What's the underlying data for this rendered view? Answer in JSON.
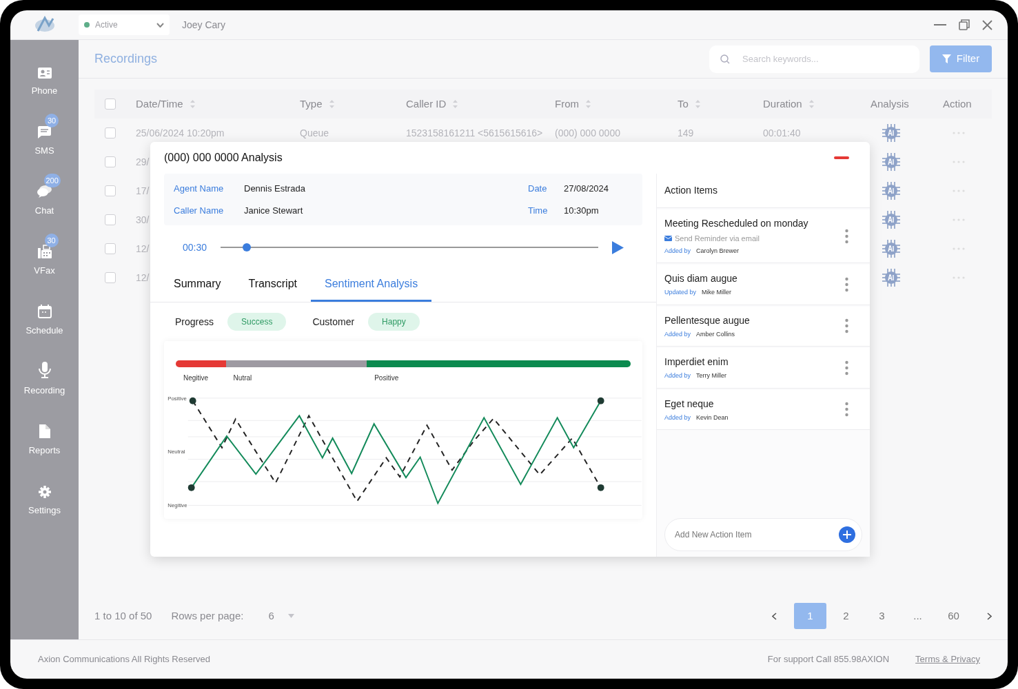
{
  "window": {
    "status": {
      "label": "Active",
      "color": "#5fae8a"
    },
    "user_name": "Joey Cary"
  },
  "sidebar": {
    "items": [
      {
        "kind": "phone",
        "label": "Phone"
      },
      {
        "kind": "sms",
        "label": "SMS",
        "badge": "30"
      },
      {
        "kind": "chat",
        "label": "Chat",
        "badge": "200"
      },
      {
        "kind": "vfax",
        "label": "VFax",
        "badge": "30"
      },
      {
        "kind": "schedule",
        "label": "Schedule"
      },
      {
        "kind": "recording",
        "label": "Recording"
      },
      {
        "kind": "reports",
        "label": "Reports"
      },
      {
        "kind": "settings",
        "label": "Settings"
      }
    ]
  },
  "page": {
    "title": "Recordings",
    "search": {
      "placeholder": "Search keywords..."
    },
    "filter_button": "Filter"
  },
  "table": {
    "header_checked": false,
    "columns": [
      {
        "label": "Date/Time",
        "sortable": true
      },
      {
        "label": "Type",
        "sortable": true
      },
      {
        "label": "Caller ID",
        "sortable": true
      },
      {
        "label": "From",
        "sortable": true
      },
      {
        "label": "To",
        "sortable": true
      },
      {
        "label": "Duration",
        "sortable": true
      },
      {
        "label": "Analysis",
        "sortable": false
      },
      {
        "label": "Action",
        "sortable": false
      }
    ],
    "rows": [
      {
        "checked": false,
        "cells": [
          "25/06/2024 10:20pm",
          "Queue",
          "1523158161211 <5615615616>",
          "(000) 000 0000",
          "149",
          "00:01:40"
        ]
      },
      {
        "checked": false,
        "cells": [
          "29/"
        ]
      },
      {
        "checked": false,
        "cells": [
          "17/"
        ]
      },
      {
        "checked": false,
        "cells": [
          "30/"
        ]
      },
      {
        "checked": false,
        "cells": [
          "12/"
        ]
      },
      {
        "checked": false,
        "cells": [
          "12/"
        ]
      }
    ]
  },
  "pagination": {
    "range": "1 to 10 of 50",
    "rows_per_page_label": "Rows per page:",
    "rows_per_page": "6",
    "pages": [
      {
        "label": "1",
        "selected": true
      },
      {
        "label": "2",
        "selected": false
      },
      {
        "label": "3",
        "selected": false
      },
      {
        "label": "...",
        "selected": false
      },
      {
        "label": "60",
        "selected": false
      }
    ]
  },
  "footer": {
    "copyright": "Axion Communications All Rights Reserved",
    "support": "For support Call 855.98AXION",
    "terms_link": "Terms & Privacy"
  },
  "analysis_dialog": {
    "title": "(000) 000 0000 Analysis",
    "details": [
      {
        "label": "Agent Name",
        "value": "Dennis Estrada"
      },
      {
        "label": "Date",
        "value": "27/08/2024"
      },
      {
        "label": "Caller Name",
        "value": "Janice Stewart"
      },
      {
        "label": "Time",
        "value": "10:30pm"
      }
    ],
    "player": {
      "time": "00:30",
      "level": 0.07
    },
    "tabs": [
      {
        "label": "Summary",
        "selected": false
      },
      {
        "label": "Transcript",
        "selected": false
      },
      {
        "label": "Sentiment Analysis",
        "selected": true
      }
    ],
    "status": [
      {
        "label": "Progress",
        "value": "Success"
      },
      {
        "label": "Customer",
        "value": "Happy"
      }
    ],
    "sentiment_bar": {
      "segments": [
        {
          "label": "Negitive",
          "level": 0.11,
          "color": "#e53935"
        },
        {
          "label": "Nutral",
          "level": 0.31,
          "color": "#9e9aa2"
        },
        {
          "label": "Positive",
          "level": 0.58,
          "color": "#0c8a4f"
        }
      ]
    },
    "sentiment_chart": {
      "y_labels": [
        "Positive",
        "Neutral",
        "Negitive"
      ]
    },
    "action_items": {
      "title": "Action Items",
      "items": [
        {
          "title": "Meeting Rescheduled on monday",
          "note": "Send Reminder via email",
          "by_label": "Added by",
          "by": "Carolyn Brewer"
        },
        {
          "title": "Quis diam augue",
          "by_label": "Updated by",
          "by": "Mike Miller"
        },
        {
          "title": "Pellentesque augue",
          "by_label": "Added by",
          "by": "Amber Collins"
        },
        {
          "title": "Imperdiet enim",
          "by_label": "Added by",
          "by": "Terry Miller"
        },
        {
          "title": "Eget neque",
          "by_label": "Added by",
          "by": "Kevin Dean"
        }
      ],
      "add_placeholder": "Add New Action Item"
    }
  }
}
